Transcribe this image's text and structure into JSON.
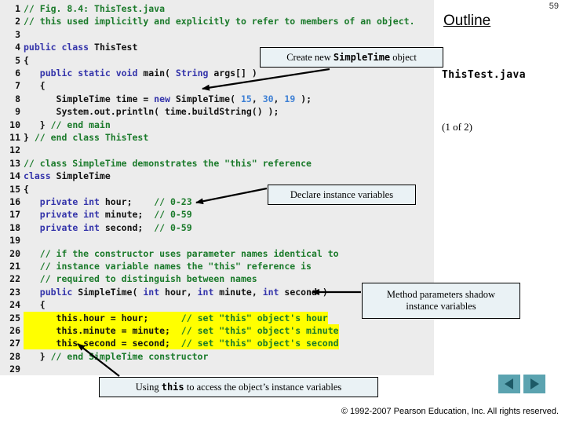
{
  "page_number": "59",
  "outline": {
    "title": "Outline",
    "file_name": "ThisTest.java",
    "pages_label": "(1 of 2)"
  },
  "footer": {
    "copyright": "© 1992-2007 Pearson Education, Inc.  All rights reserved."
  },
  "nav": {
    "prev_label": "previous-slide",
    "next_label": "next-slide"
  },
  "callouts": [
    {
      "id": "create",
      "parts": [
        {
          "text": "Create new ",
          "mono": false
        },
        {
          "text": "SimpleTime",
          "mono": true
        },
        {
          "text": " object",
          "mono": false
        }
      ],
      "plain": "Create new SimpleTime object"
    },
    {
      "id": "declare",
      "parts": [
        {
          "text": "Declare instance variables",
          "mono": false
        }
      ],
      "plain": "Declare instance variables"
    },
    {
      "id": "shadow",
      "parts": [
        {
          "text": "Method parameters shadow instance variables",
          "mono": false
        }
      ],
      "line1": "Method parameters shadow",
      "line2": "instance variables",
      "plain": "Method parameters shadow instance variables"
    },
    {
      "id": "using",
      "parts": [
        {
          "text": "Using ",
          "mono": false
        },
        {
          "text": "this",
          "mono": true
        },
        {
          "text": " to access the object’s instance variables",
          "mono": false
        }
      ],
      "plain": "Using this to access the object’s instance variables"
    }
  ],
  "code": {
    "language": "java",
    "file": "ThisTest.java",
    "lines": [
      {
        "n": "1",
        "highlight": false,
        "tokens": [
          {
            "t": "// Fig. 8.4: ThisTest.java",
            "c": "cm"
          }
        ]
      },
      {
        "n": "2",
        "highlight": false,
        "tokens": [
          {
            "t": "// this used implicitly and explicitly to refer to members of an object.",
            "c": "cm"
          }
        ]
      },
      {
        "n": "3",
        "highlight": false,
        "tokens": []
      },
      {
        "n": "4",
        "highlight": false,
        "tokens": [
          {
            "t": "public class ",
            "c": "kw"
          },
          {
            "t": "ThisTest",
            "c": "id"
          }
        ]
      },
      {
        "n": "5",
        "highlight": false,
        "tokens": [
          {
            "t": "{",
            "c": "id"
          }
        ]
      },
      {
        "n": "6",
        "highlight": false,
        "tokens": [
          {
            "t": "   ",
            "c": "id"
          },
          {
            "t": "public static void ",
            "c": "kw"
          },
          {
            "t": "main( ",
            "c": "id"
          },
          {
            "t": "String",
            "c": "kw"
          },
          {
            "t": " args[] )",
            "c": "id"
          }
        ]
      },
      {
        "n": "7",
        "highlight": false,
        "tokens": [
          {
            "t": "   {",
            "c": "id"
          }
        ]
      },
      {
        "n": "8",
        "highlight": false,
        "tokens": [
          {
            "t": "      SimpleTime time = ",
            "c": "id"
          },
          {
            "t": "new ",
            "c": "kw"
          },
          {
            "t": "SimpleTime( ",
            "c": "id"
          },
          {
            "t": "15",
            "c": "num"
          },
          {
            "t": ", ",
            "c": "id"
          },
          {
            "t": "30",
            "c": "num"
          },
          {
            "t": ", ",
            "c": "id"
          },
          {
            "t": "19",
            "c": "num"
          },
          {
            "t": " );",
            "c": "id"
          }
        ]
      },
      {
        "n": "9",
        "highlight": false,
        "tokens": [
          {
            "t": "      System.out.println( time.buildString() );",
            "c": "id"
          }
        ]
      },
      {
        "n": "10",
        "highlight": false,
        "tokens": [
          {
            "t": "   } ",
            "c": "id"
          },
          {
            "t": "// end main",
            "c": "cm"
          }
        ]
      },
      {
        "n": "11",
        "highlight": false,
        "tokens": [
          {
            "t": "} ",
            "c": "id"
          },
          {
            "t": "// end class ThisTest",
            "c": "cm"
          }
        ]
      },
      {
        "n": "12",
        "highlight": false,
        "tokens": []
      },
      {
        "n": "13",
        "highlight": false,
        "tokens": [
          {
            "t": "// class SimpleTime demonstrates the \"this\" reference",
            "c": "cm"
          }
        ]
      },
      {
        "n": "14",
        "highlight": false,
        "tokens": [
          {
            "t": "class ",
            "c": "kw"
          },
          {
            "t": "SimpleTime",
            "c": "id"
          }
        ]
      },
      {
        "n": "15",
        "highlight": false,
        "tokens": [
          {
            "t": "{",
            "c": "id"
          }
        ]
      },
      {
        "n": "16",
        "highlight": false,
        "tokens": [
          {
            "t": "   ",
            "c": "id"
          },
          {
            "t": "private int ",
            "c": "kw"
          },
          {
            "t": "hour;    ",
            "c": "id"
          },
          {
            "t": "// 0-23",
            "c": "cm"
          }
        ]
      },
      {
        "n": "17",
        "highlight": false,
        "tokens": [
          {
            "t": "   ",
            "c": "id"
          },
          {
            "t": "private int ",
            "c": "kw"
          },
          {
            "t": "minute;  ",
            "c": "id"
          },
          {
            "t": "// 0-59",
            "c": "cm"
          }
        ]
      },
      {
        "n": "18",
        "highlight": false,
        "tokens": [
          {
            "t": "   ",
            "c": "id"
          },
          {
            "t": "private int ",
            "c": "kw"
          },
          {
            "t": "second;  ",
            "c": "id"
          },
          {
            "t": "// 0-59",
            "c": "cm"
          }
        ]
      },
      {
        "n": "19",
        "highlight": false,
        "tokens": []
      },
      {
        "n": "20",
        "highlight": false,
        "tokens": [
          {
            "t": "   ",
            "c": "id"
          },
          {
            "t": "// if the constructor uses parameter names identical to",
            "c": "cm"
          }
        ]
      },
      {
        "n": "21",
        "highlight": false,
        "tokens": [
          {
            "t": "   ",
            "c": "id"
          },
          {
            "t": "// instance variable names the \"this\" reference is",
            "c": "cm"
          }
        ]
      },
      {
        "n": "22",
        "highlight": false,
        "tokens": [
          {
            "t": "   ",
            "c": "id"
          },
          {
            "t": "// required to distinguish between names",
            "c": "cm"
          }
        ]
      },
      {
        "n": "23",
        "highlight": false,
        "tokens": [
          {
            "t": "   ",
            "c": "id"
          },
          {
            "t": "public ",
            "c": "kw"
          },
          {
            "t": "SimpleTime( ",
            "c": "id"
          },
          {
            "t": "int ",
            "c": "kw"
          },
          {
            "t": "hour, ",
            "c": "id"
          },
          {
            "t": "int ",
            "c": "kw"
          },
          {
            "t": "minute, ",
            "c": "id"
          },
          {
            "t": "int ",
            "c": "kw"
          },
          {
            "t": "second )",
            "c": "id"
          }
        ]
      },
      {
        "n": "24",
        "highlight": false,
        "tokens": [
          {
            "t": "   {",
            "c": "id"
          }
        ]
      },
      {
        "n": "25",
        "highlight": true,
        "tokens": [
          {
            "t": "      this.hour = hour;      ",
            "c": "id"
          },
          {
            "t": "// set \"this\" object's hour",
            "c": "cm"
          }
        ]
      },
      {
        "n": "26",
        "highlight": true,
        "tokens": [
          {
            "t": "      this.minute = minute;  ",
            "c": "id"
          },
          {
            "t": "// set \"this\" object's minute",
            "c": "cm"
          }
        ]
      },
      {
        "n": "27",
        "highlight": true,
        "tokens": [
          {
            "t": "      this.second = second;  ",
            "c": "id"
          },
          {
            "t": "// set \"this\" object's second",
            "c": "cm"
          }
        ]
      },
      {
        "n": "28",
        "highlight": false,
        "tokens": [
          {
            "t": "   } ",
            "c": "id"
          },
          {
            "t": "// end SimpleTime constructor",
            "c": "cm"
          }
        ]
      },
      {
        "n": "29",
        "highlight": false,
        "tokens": []
      }
    ]
  },
  "colors": {
    "keyword": "#3333aa",
    "comment": "#1a7a2a",
    "number": "#3d7fd4",
    "identifier": "#111111",
    "highlight": "#ffff00",
    "code_background": "#ececec",
    "callout_background": "#eaf2f5",
    "nav_button": "#5ba3b0"
  }
}
